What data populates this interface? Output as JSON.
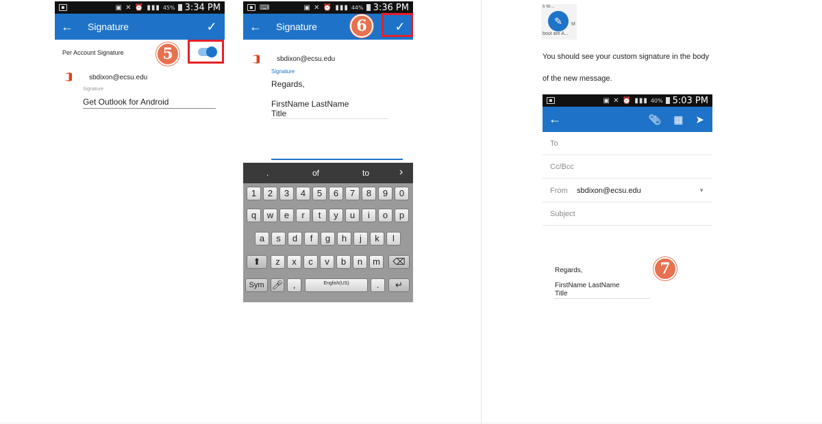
{
  "panel1": {
    "status_time": "3:34 PM",
    "battery": "45%",
    "title": "Signature",
    "toggle_label": "Per Account Signature",
    "step": "5",
    "email": "sbdixon@ecsu.edu",
    "signature_label": "Signature",
    "signature_value": "Get Outlook for Android"
  },
  "panel2": {
    "status_time": "3:36 PM",
    "battery": "44%",
    "title": "Signature",
    "step": "6",
    "email": "sbdixon@ecsu.edu",
    "signature_label": "Signature",
    "lines": [
      "Regards,",
      "FirstName LastName",
      "Title"
    ]
  },
  "keyboard": {
    "suggestions": [
      ".",
      "of",
      "to",
      "›"
    ],
    "numbers": [
      "1",
      "2",
      "3",
      "4",
      "5",
      "6",
      "7",
      "8",
      "9",
      "0"
    ],
    "row1": [
      "q",
      "w",
      "e",
      "r",
      "t",
      "y",
      "u",
      "i",
      "o",
      "p"
    ],
    "row2": [
      "a",
      "s",
      "d",
      "f",
      "g",
      "h",
      "j",
      "k",
      "l"
    ],
    "row3": [
      "z",
      "x",
      "c",
      "v",
      "b",
      "n",
      "m"
    ],
    "sym": "Sym",
    "comma": ",",
    "space": "English(US)",
    "period": "."
  },
  "panel3": {
    "thumb_text_top": "s to...",
    "thumb_text_side": "M",
    "thumb_text_bottom": "bout are A...",
    "text_line1": "You should see your custom signature in the body",
    "text_line2": "of the new message.",
    "status_time": "5:03 PM",
    "battery": "40%",
    "fields": {
      "to": "To",
      "cc": "Cc/Bcc",
      "from_label": "From",
      "from_value": "sbdixon@ecsu.edu",
      "subject": "Subject"
    },
    "step": "7",
    "sig_lines": [
      "Regards,",
      "FirstName LastName",
      "Title"
    ]
  },
  "colors": {
    "appbar": "#1e73c8",
    "step_badge": "#e8714f",
    "highlight_box": "#e3202a"
  }
}
